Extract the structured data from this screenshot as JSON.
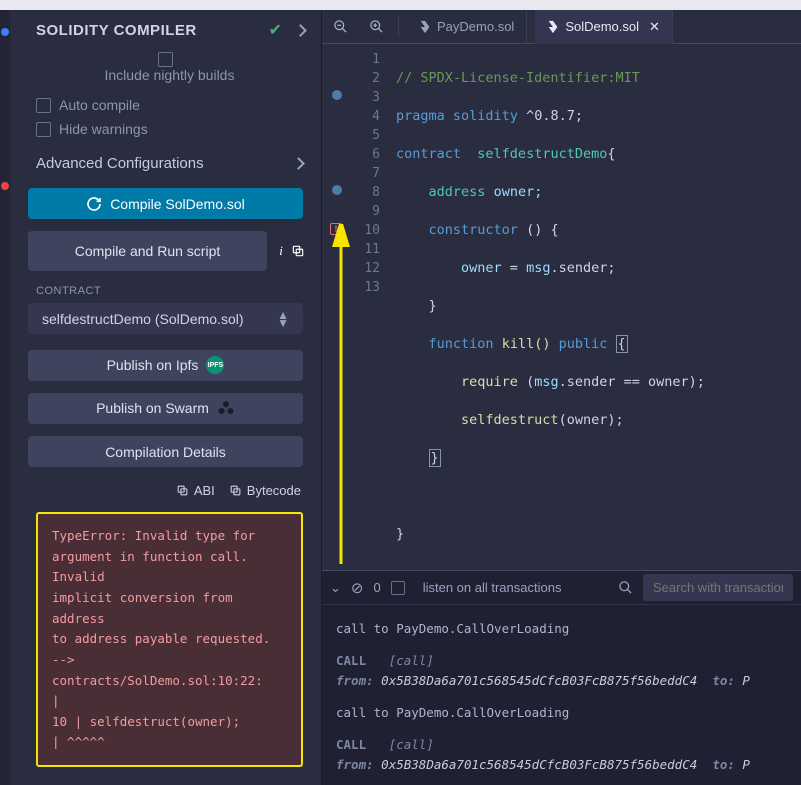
{
  "header": {
    "title": "SOLIDITY COMPILER"
  },
  "options": {
    "nightly": "Include nightly builds",
    "auto": "Auto compile",
    "hide_warn": "Hide warnings"
  },
  "advanced": {
    "label": "Advanced Configurations"
  },
  "compile_btn": "Compile SolDemo.sol",
  "run_btn": "Compile and Run script",
  "contract_label": "CONTRACT",
  "contract_select": "selfdestructDemo (SolDemo.sol)",
  "publish_ipfs": "Publish on Ipfs",
  "publish_swarm": "Publish on Swarm",
  "comp_details": "Compilation Details",
  "links": {
    "abi": "ABI",
    "bytecode": "Bytecode"
  },
  "error": {
    "line1": "TypeError: Invalid type for",
    "line2": "argument in function call. Invalid",
    "line3": "implicit conversion from address",
    "line4": "to address payable requested.",
    "line5": "--> contracts/SolDemo.sol:10:22:",
    "line6": "|",
    "line7": "10 | selfdestruct(owner);",
    "line8": "| ^^^^^"
  },
  "tabs": {
    "t1": "PayDemo.sol",
    "t2": "SolDemo.sol"
  },
  "gutter": [
    "1",
    "2",
    "3",
    "4",
    "5",
    "6",
    "7",
    "8",
    "9",
    "10",
    "11",
    "12",
    "13"
  ],
  "code": {
    "l1_comment": "// SPDX-License-Identifier:MIT",
    "l2_pragma": "pragma",
    "l2_sol": "solidity",
    "l2_ver": "^0.8.7;",
    "l3_kw": "contract",
    "l3_name": "selfdestructDemo",
    "l3_brace": "{",
    "l4_ty": "address",
    "l4_id": "owner;",
    "l5_kw": "constructor",
    "l5_par": "()",
    "l5_brace": "{",
    "l6_id": "owner",
    "l6_eq": " = ",
    "l6_msg": "msg",
    "l6_sender": ".sender;",
    "l7": "}",
    "l8_kw": "function",
    "l8_name": "kill()",
    "l8_pub": "public",
    "l8_brace": "{",
    "l9_req": "require",
    "l9_open": "(",
    "l9_msg": "msg",
    "l9_rest": ".sender == owner);",
    "l10_sd": "selfdestruct",
    "l10_arg": "(owner);",
    "l11": "}",
    "l12": "",
    "l13": "}"
  },
  "terminal": {
    "listen": "listen on all transactions",
    "search_ph": "Search with transaction",
    "zero": "0",
    "r1": "call to PayDemo.CallOverLoading",
    "r2_call": "CALL",
    "r2_tag": "[call]",
    "r2_from": "from:",
    "r2_hash": "0x5B38Da6a701c568545dCfcB03FcB875f56beddC4",
    "r2_to": "to:",
    "r2_toval": "P",
    "r3": "call to PayDemo.CallOverLoading",
    "r4_call": "CALL",
    "r4_tag": "[call]",
    "r4_from": "from:",
    "r4_hash": "0x5B38Da6a701c568545dCfcB03FcB875f56beddC4",
    "r4_to": "to:",
    "r4_toval": "P"
  }
}
